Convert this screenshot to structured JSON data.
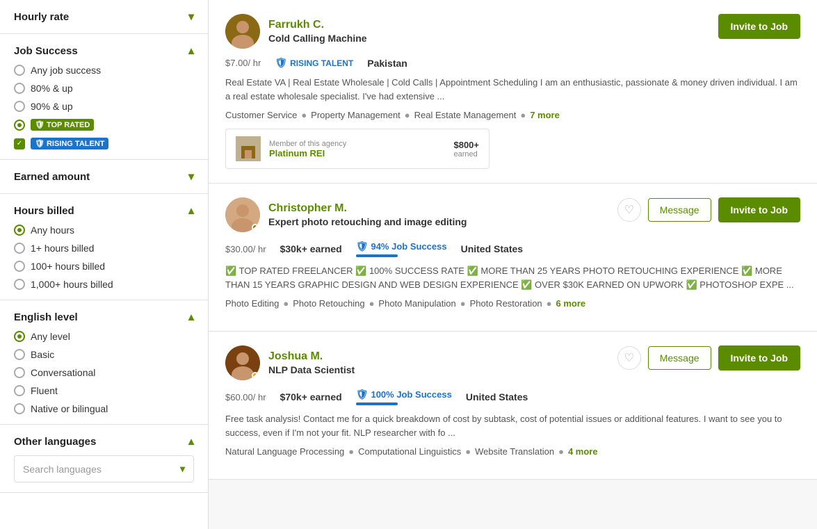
{
  "sidebar": {
    "sections": [
      {
        "id": "hourly-rate",
        "title": "Hourly rate",
        "collapsed": true,
        "chevron": "▾"
      },
      {
        "id": "job-success",
        "title": "Job Success",
        "collapsed": false,
        "chevron": "▴",
        "options": [
          {
            "type": "radio",
            "label": "Any job success",
            "selected": false
          },
          {
            "type": "radio",
            "label": "80% & up",
            "selected": false
          },
          {
            "type": "radio",
            "label": "90% & up",
            "selected": false
          },
          {
            "type": "checkbox",
            "label": "TOP RATED",
            "selected": true,
            "badge": "top-rated"
          },
          {
            "type": "checkbox",
            "label": "RISING TALENT",
            "selected": true,
            "badge": "rising-talent"
          }
        ]
      },
      {
        "id": "earned-amount",
        "title": "Earned amount",
        "collapsed": true,
        "chevron": "▾"
      },
      {
        "id": "hours-billed",
        "title": "Hours billed",
        "collapsed": false,
        "chevron": "▴",
        "options": [
          {
            "type": "radio",
            "label": "Any hours",
            "selected": true
          },
          {
            "type": "radio",
            "label": "1+ hours billed",
            "selected": false
          },
          {
            "type": "radio",
            "label": "100+ hours billed",
            "selected": false
          },
          {
            "type": "radio",
            "label": "1,000+ hours billed",
            "selected": false
          }
        ]
      },
      {
        "id": "english-level",
        "title": "English level",
        "collapsed": false,
        "chevron": "▴",
        "options": [
          {
            "type": "radio",
            "label": "Any level",
            "selected": true
          },
          {
            "type": "radio",
            "label": "Basic",
            "selected": false
          },
          {
            "type": "radio",
            "label": "Conversational",
            "selected": false
          },
          {
            "type": "radio",
            "label": "Fluent",
            "selected": false
          },
          {
            "type": "radio",
            "label": "Native or bilingual",
            "selected": false
          }
        ]
      },
      {
        "id": "other-languages",
        "title": "Other languages",
        "collapsed": false,
        "chevron": "▴",
        "search_placeholder": "Search languages"
      }
    ]
  },
  "freelancers": [
    {
      "id": "farrukh",
      "name": "Farrukh C.",
      "title": "Cold Calling Machine",
      "rate": "$7.00",
      "rate_unit": "/ hr",
      "earned": null,
      "job_success": null,
      "location": "Pakistan",
      "badge": "RISING TALENT",
      "badge_type": "rising-talent",
      "description": "Real Estate VA | Real Estate Wholesale | Cold Calls | Appointment Scheduling I am an enthusiastic, passionate & money driven individual. I am a real estate wholesale specialist. I've had extensive ...",
      "skills": [
        "Customer Service",
        "Property Management",
        "Real Estate Management"
      ],
      "skills_more": "7 more",
      "has_message": false,
      "has_heart": false,
      "invite_label": "Invite to Job",
      "agency": {
        "show": true,
        "label": "Member of this agency",
        "name": "Platinum REI",
        "earned": "$800+",
        "earned_label": "earned"
      }
    },
    {
      "id": "christopher",
      "name": "Christopher M.",
      "title": "Expert photo retouching and image editing",
      "rate": "$30.00",
      "rate_unit": "/ hr",
      "earned": "$30k+ earned",
      "job_success": "94% Job Success",
      "job_success_pct": 94,
      "location": "United States",
      "badge": null,
      "description": "✅ TOP RATED FREELANCER ✅ 100% SUCCESS RATE ✅ MORE THAN 25 YEARS PHOTO RETOUCHING EXPERIENCE ✅ MORE THAN 15 YEARS GRAPHIC DESIGN AND WEB DESIGN EXPERIENCE ✅ OVER $30K EARNED ON UPWORK ✅ PHOTOSHOP EXPE ...",
      "skills": [
        "Photo Editing",
        "Photo Retouching",
        "Photo Manipulation",
        "Photo Restoration"
      ],
      "skills_more": "6 more",
      "has_message": true,
      "has_heart": true,
      "invite_label": "Invite to Job",
      "message_label": "Message",
      "agency": {
        "show": false
      }
    },
    {
      "id": "joshua",
      "name": "Joshua M.",
      "title": "NLP Data Scientist",
      "rate": "$60.00",
      "rate_unit": "/ hr",
      "earned": "$70k+ earned",
      "job_success": "100% Job Success",
      "job_success_pct": 100,
      "location": "United States",
      "badge": null,
      "description": "Free task analysis! Contact me for a quick breakdown of cost by subtask, cost of potential issues or additional features. I want to see you to success, even if I'm not your fit. NLP researcher with fo ...",
      "skills": [
        "Natural Language Processing",
        "Computational Linguistics",
        "Website Translation"
      ],
      "skills_more": "4 more",
      "has_message": true,
      "has_heart": true,
      "invite_label": "Invite to Job",
      "message_label": "Message",
      "agency": {
        "show": false
      }
    }
  ],
  "colors": {
    "green": "#5b8c00",
    "blue": "#1d73c8"
  }
}
